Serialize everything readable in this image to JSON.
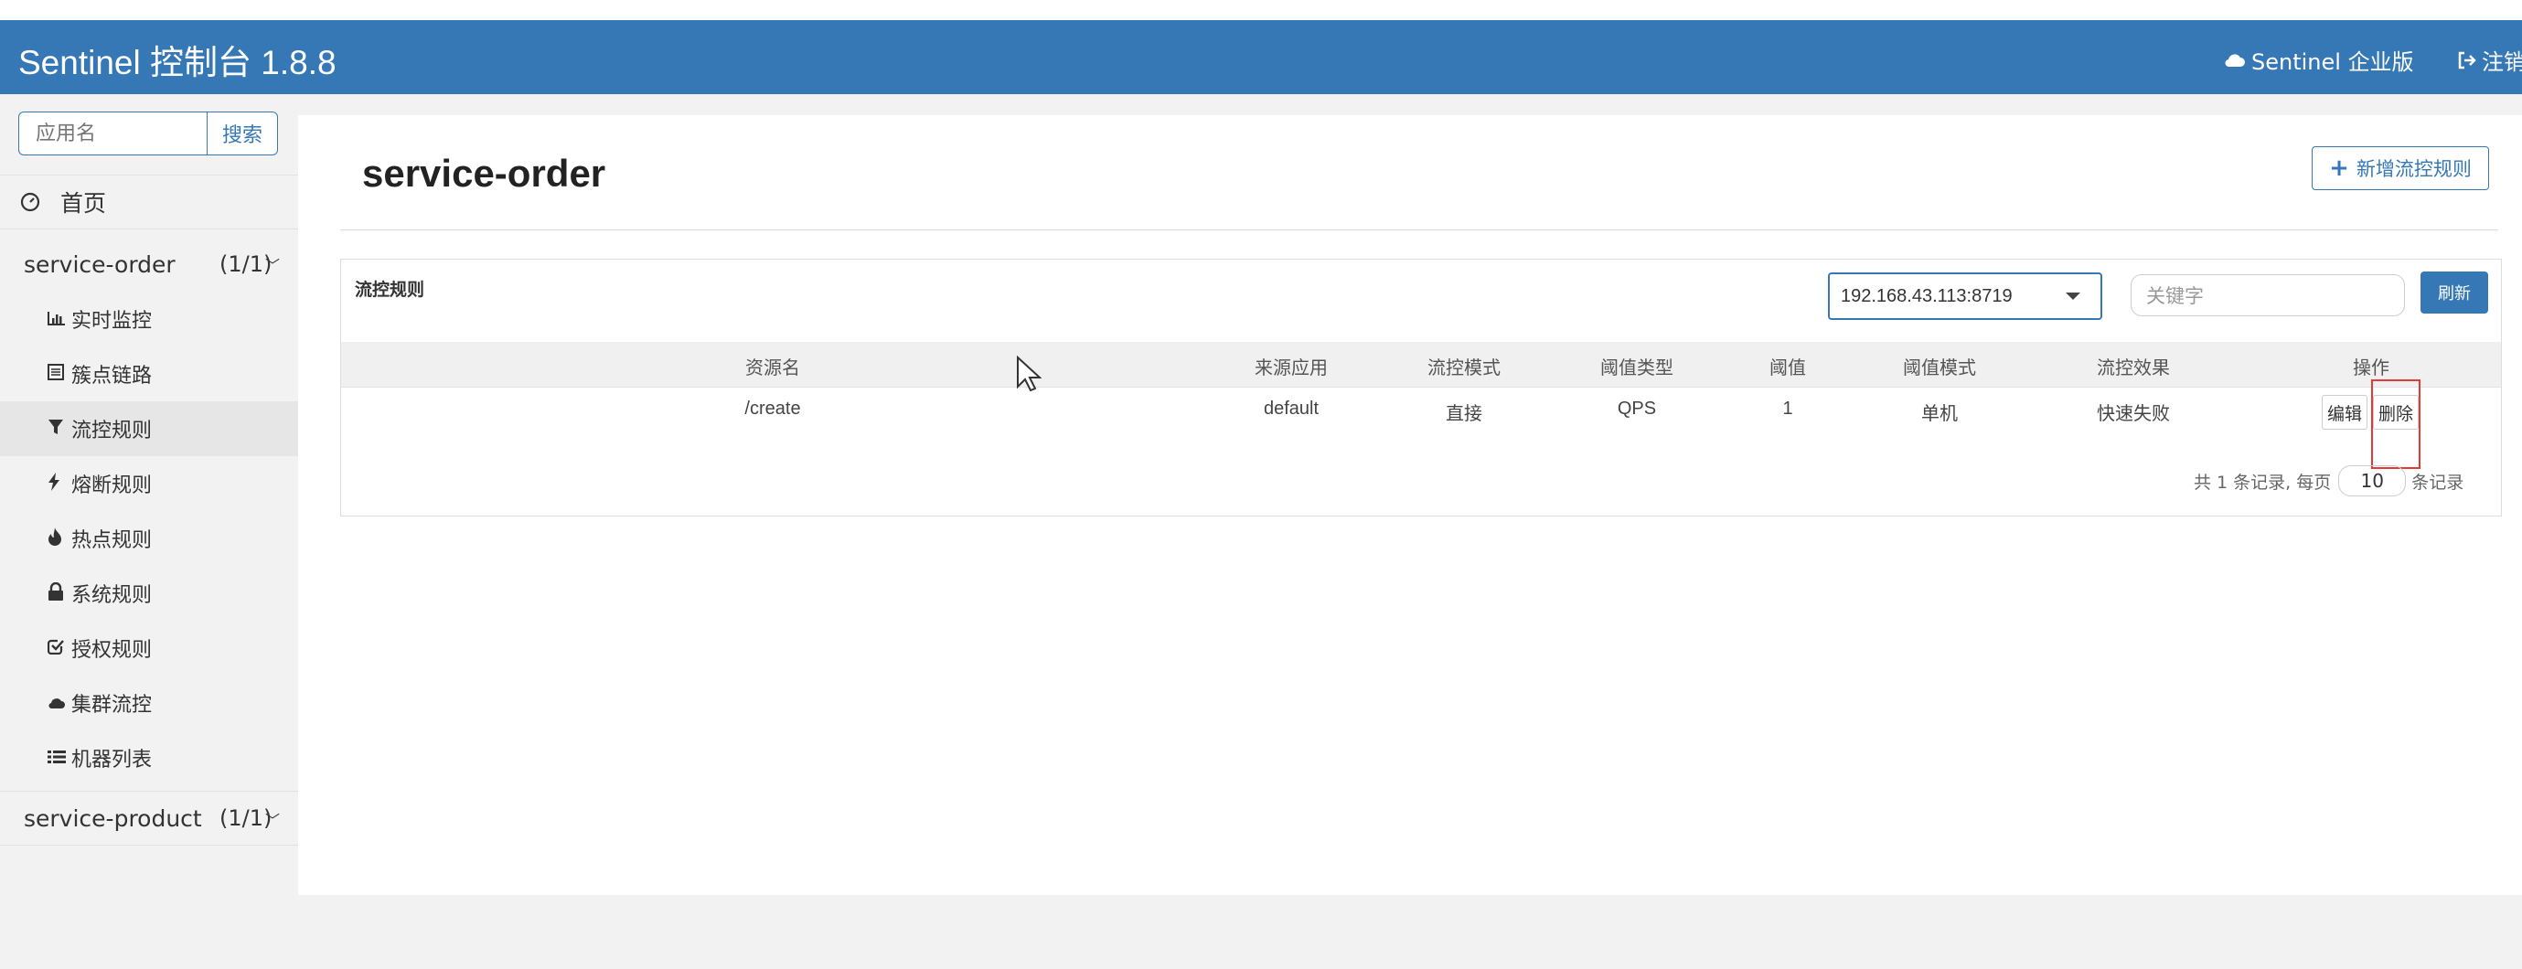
{
  "header": {
    "brand": "Sentinel 控制台 1.8.8",
    "enterprise_label": "Sentinel 企业版",
    "logout_label": "注销"
  },
  "sidebar": {
    "search_placeholder": "应用名",
    "search_button": "搜索",
    "home_label": "首页",
    "apps": [
      {
        "name": "service-order",
        "count": "(1/1)",
        "items": [
          {
            "label": "实时监控",
            "icon": "bar-chart-icon"
          },
          {
            "label": "簇点链路",
            "icon": "list-alt-icon"
          },
          {
            "label": "流控规则",
            "icon": "filter-icon",
            "active": true
          },
          {
            "label": "熔断规则",
            "icon": "bolt-icon"
          },
          {
            "label": "热点规则",
            "icon": "fire-icon"
          },
          {
            "label": "系统规则",
            "icon": "lock-icon"
          },
          {
            "label": "授权规则",
            "icon": "check-square-icon"
          },
          {
            "label": "集群流控",
            "icon": "cloud-icon"
          },
          {
            "label": "机器列表",
            "icon": "list-icon"
          }
        ]
      },
      {
        "name": "service-product",
        "count": "(1/1)"
      }
    ]
  },
  "main": {
    "title": "service-order",
    "add_button": "新增流控规则",
    "panel_title": "流控规则",
    "ip_select_value": "192.168.43.113:8719",
    "keyword_placeholder": "关键字",
    "refresh_button": "刷新",
    "columns": [
      "资源名",
      "来源应用",
      "流控模式",
      "阈值类型",
      "阈值",
      "阈值模式",
      "流控效果",
      "操作"
    ],
    "rows": [
      {
        "resource": "/create",
        "source": "default",
        "mode": "直接",
        "threshold_type": "QPS",
        "threshold": "1",
        "threshold_mode": "单机",
        "effect": "快速失败",
        "edit": "编辑",
        "delete": "删除"
      }
    ],
    "pager": {
      "prefix": "共 1 条记录, 每页",
      "page_size": "10",
      "suffix": "条记录"
    }
  },
  "colors": {
    "brand": "#3578b5",
    "highlight": "#e53935"
  }
}
